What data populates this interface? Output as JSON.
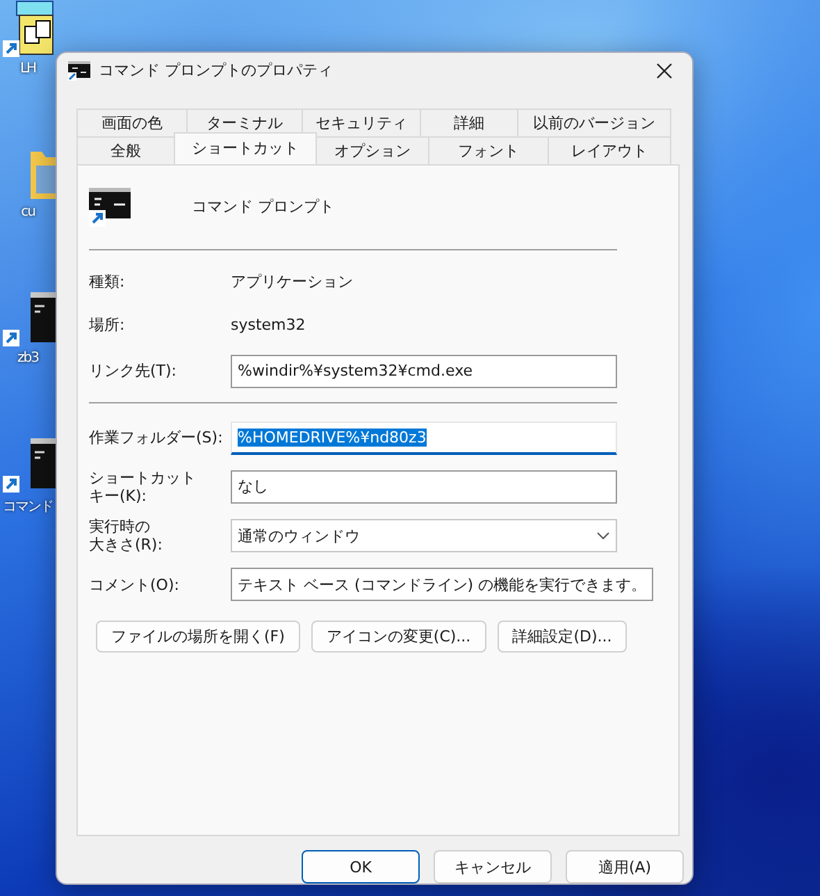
{
  "desktop_icons": [
    {
      "kind": "folder-app",
      "label": "LH"
    },
    {
      "kind": "folder",
      "label": "cu"
    },
    {
      "kind": "console",
      "label": "zb3"
    },
    {
      "kind": "console",
      "label": "コマンド"
    }
  ],
  "window": {
    "title": "コマンド プロンプトのプロパティ"
  },
  "tab_rows": [
    [
      {
        "label": "画面の色",
        "selected": false
      },
      {
        "label": "ターミナル",
        "selected": false
      },
      {
        "label": "セキュリティ",
        "selected": false
      },
      {
        "label": "詳細",
        "selected": false
      },
      {
        "label": "以前のバージョン",
        "selected": false
      }
    ],
    [
      {
        "label": "全般",
        "selected": false
      },
      {
        "label": "ショートカット",
        "selected": true
      },
      {
        "label": "オプション",
        "selected": false
      },
      {
        "label": "フォント",
        "selected": false
      },
      {
        "label": "レイアウト",
        "selected": false
      }
    ]
  ],
  "shortcut": {
    "name": "コマンド プロンプト"
  },
  "rows": [
    {
      "kind": "separator"
    },
    {
      "kind": "info",
      "label": "種類:",
      "value": "アプリケーション"
    },
    {
      "kind": "info",
      "label": "場所:",
      "value": "system32"
    },
    {
      "kind": "text",
      "label": "リンク先(T):",
      "value": "%windir%¥system32¥cmd.exe",
      "focused": false
    },
    {
      "kind": "separator"
    },
    {
      "kind": "text",
      "label": "作業フォルダー(S):",
      "value": "%HOMEDRIVE%¥nd80z3",
      "focused": true
    },
    {
      "kind": "text",
      "label": "ショートカット",
      "label_2": "キー(K):",
      "value": "なし",
      "focused": false
    },
    {
      "kind": "dropdown",
      "label": "実行時の",
      "label_2": "大きさ(R):",
      "value": "通常のウィンドウ",
      "focused": false
    },
    {
      "kind": "text",
      "label": "コメント(O):",
      "value": "テキスト ベース (コマンドライン) の機能を実行できます。",
      "focused": false
    }
  ],
  "action_buttons": [
    "ファイルの場所を開く(F)",
    "アイコンの変更(C)...",
    "詳細設定(D)..."
  ],
  "footer_buttons": [
    {
      "label": "OK",
      "default": true
    },
    {
      "label": "キャンセル",
      "default": false
    },
    {
      "label": "適用(A)",
      "default": false
    }
  ]
}
